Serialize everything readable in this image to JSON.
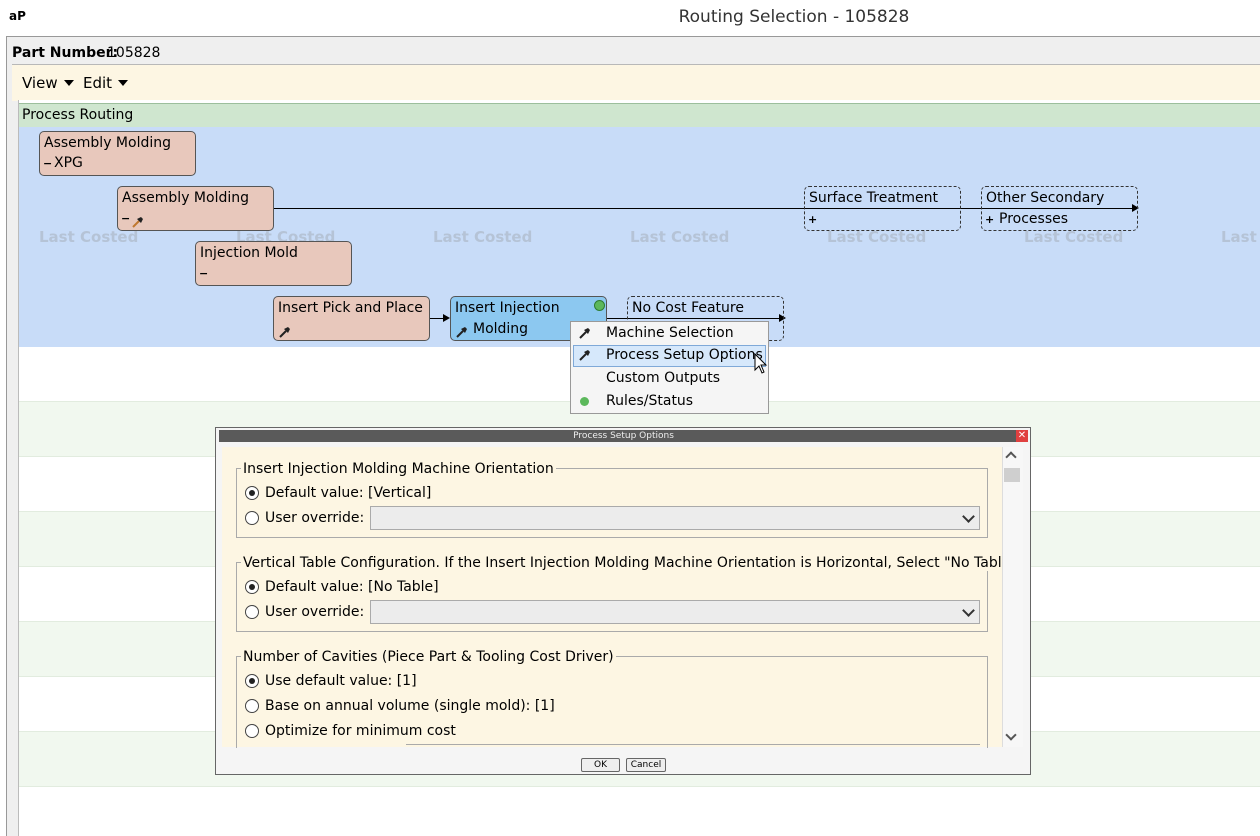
{
  "window": {
    "logo": "aP",
    "title": "Routing Selection - 105828"
  },
  "part": {
    "label": "Part Number:",
    "value": "105828"
  },
  "menubar": {
    "view": "View",
    "edit": "Edit"
  },
  "routing": {
    "header": "Process Routing",
    "last_costed": "Last Costed",
    "nodes": [
      {
        "line1": "Assembly Molding",
        "line2": "XPG"
      },
      {
        "line1": "Assembly Molding",
        "line2": ""
      },
      {
        "line1": "Injection Mold",
        "line2": ""
      },
      {
        "line1": "Insert Pick and Place",
        "line2": ""
      },
      {
        "line1": "Insert Injection",
        "line2": "Molding"
      },
      {
        "line1": "No Cost Feature",
        "line2": ""
      },
      {
        "line1": "Surface Treatment",
        "line2": ""
      },
      {
        "line1": "Other Secondary",
        "line2": "Processes"
      }
    ],
    "last_costed_partial": "Last"
  },
  "context_menu": {
    "items": [
      "Machine Selection",
      "Process Setup Options",
      "Custom Outputs",
      "Rules/Status"
    ]
  },
  "dialog": {
    "title": "Process Setup Options",
    "close": "x",
    "groups": [
      {
        "legend": "Insert Injection Molding Machine Orientation",
        "options": [
          "Default value: [Vertical]",
          "User override:"
        ]
      },
      {
        "legend": "Vertical Table Configuration. If the Insert Injection Molding Machine Orientation is Horizontal, Select \"No Table\"",
        "options": [
          "Default value: [No Table]",
          "User override:"
        ]
      },
      {
        "legend": "Number of Cavities (Piece Part & Tooling Cost Driver)",
        "options": [
          "Use default value: [1]",
          "Base on annual volume (single mold): [1]",
          "Optimize for minimum cost"
        ]
      }
    ],
    "ok": "OK",
    "cancel": "Cancel"
  },
  "colors": {
    "canvas": "#c8dcf8",
    "node": "#e8c8bc",
    "selected_node": "#8cc8f0",
    "menubar": "#fdf6e3",
    "routing_header": "#cfe6cf"
  },
  "icons": [
    "hammer-icon",
    "minus-icon",
    "plus-icon",
    "status-dot-icon",
    "close-icon",
    "dropdown-chevron-icon"
  ]
}
